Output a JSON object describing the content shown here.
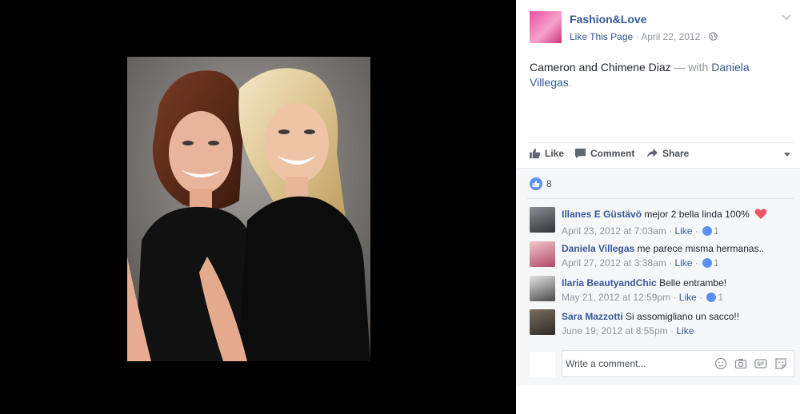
{
  "post": {
    "page_name": "Fashion&Love",
    "like_page_label": "Like This Page",
    "date": "April 22, 2012",
    "caption": {
      "text": "Cameron and Chimene Diaz",
      "with_label": "— with",
      "tagged_name": "Daniela Villegas",
      "end": "."
    }
  },
  "actions": {
    "like_label": "Like",
    "comment_label": "Comment",
    "share_label": "Share"
  },
  "reactions": {
    "count": "8"
  },
  "comments": [
    {
      "author": "Illanes E Güstävö",
      "text": "mejor 2 bella linda 100%",
      "time": "April 23, 2012 at 7:03am",
      "like_label": "Like",
      "likes": "1",
      "has_heart": true
    },
    {
      "author": "Daniela Villegas",
      "text": "me parece misma hermanas..",
      "time": "April 27, 2012 at 3:38am",
      "like_label": "Like",
      "likes": "1"
    },
    {
      "author": "Ilaria BeautyandChic",
      "text": "Belle entrambe!",
      "time": "May 21, 2012 at 12:59pm",
      "like_label": "Like",
      "likes": "1"
    },
    {
      "author": "Sara Mazzotti",
      "text": "Si assomigliano un sacco!!",
      "time": "June 19, 2012 at 8:55pm",
      "like_label": "Like",
      "likes": ""
    }
  ],
  "composer": {
    "placeholder": "Write a comment..."
  },
  "icons": {
    "globe": "globe-icon",
    "chevron": "chevron-down-icon",
    "thumb": "thumbs-up-icon",
    "comment": "comment-icon",
    "share": "share-icon",
    "emoji": "emoji-icon",
    "camera": "camera-icon",
    "gif": "gif-icon",
    "sticker": "sticker-icon"
  },
  "colors": {
    "link": "#365899",
    "like_blue": "#5890ff",
    "heart": "#f25268"
  }
}
